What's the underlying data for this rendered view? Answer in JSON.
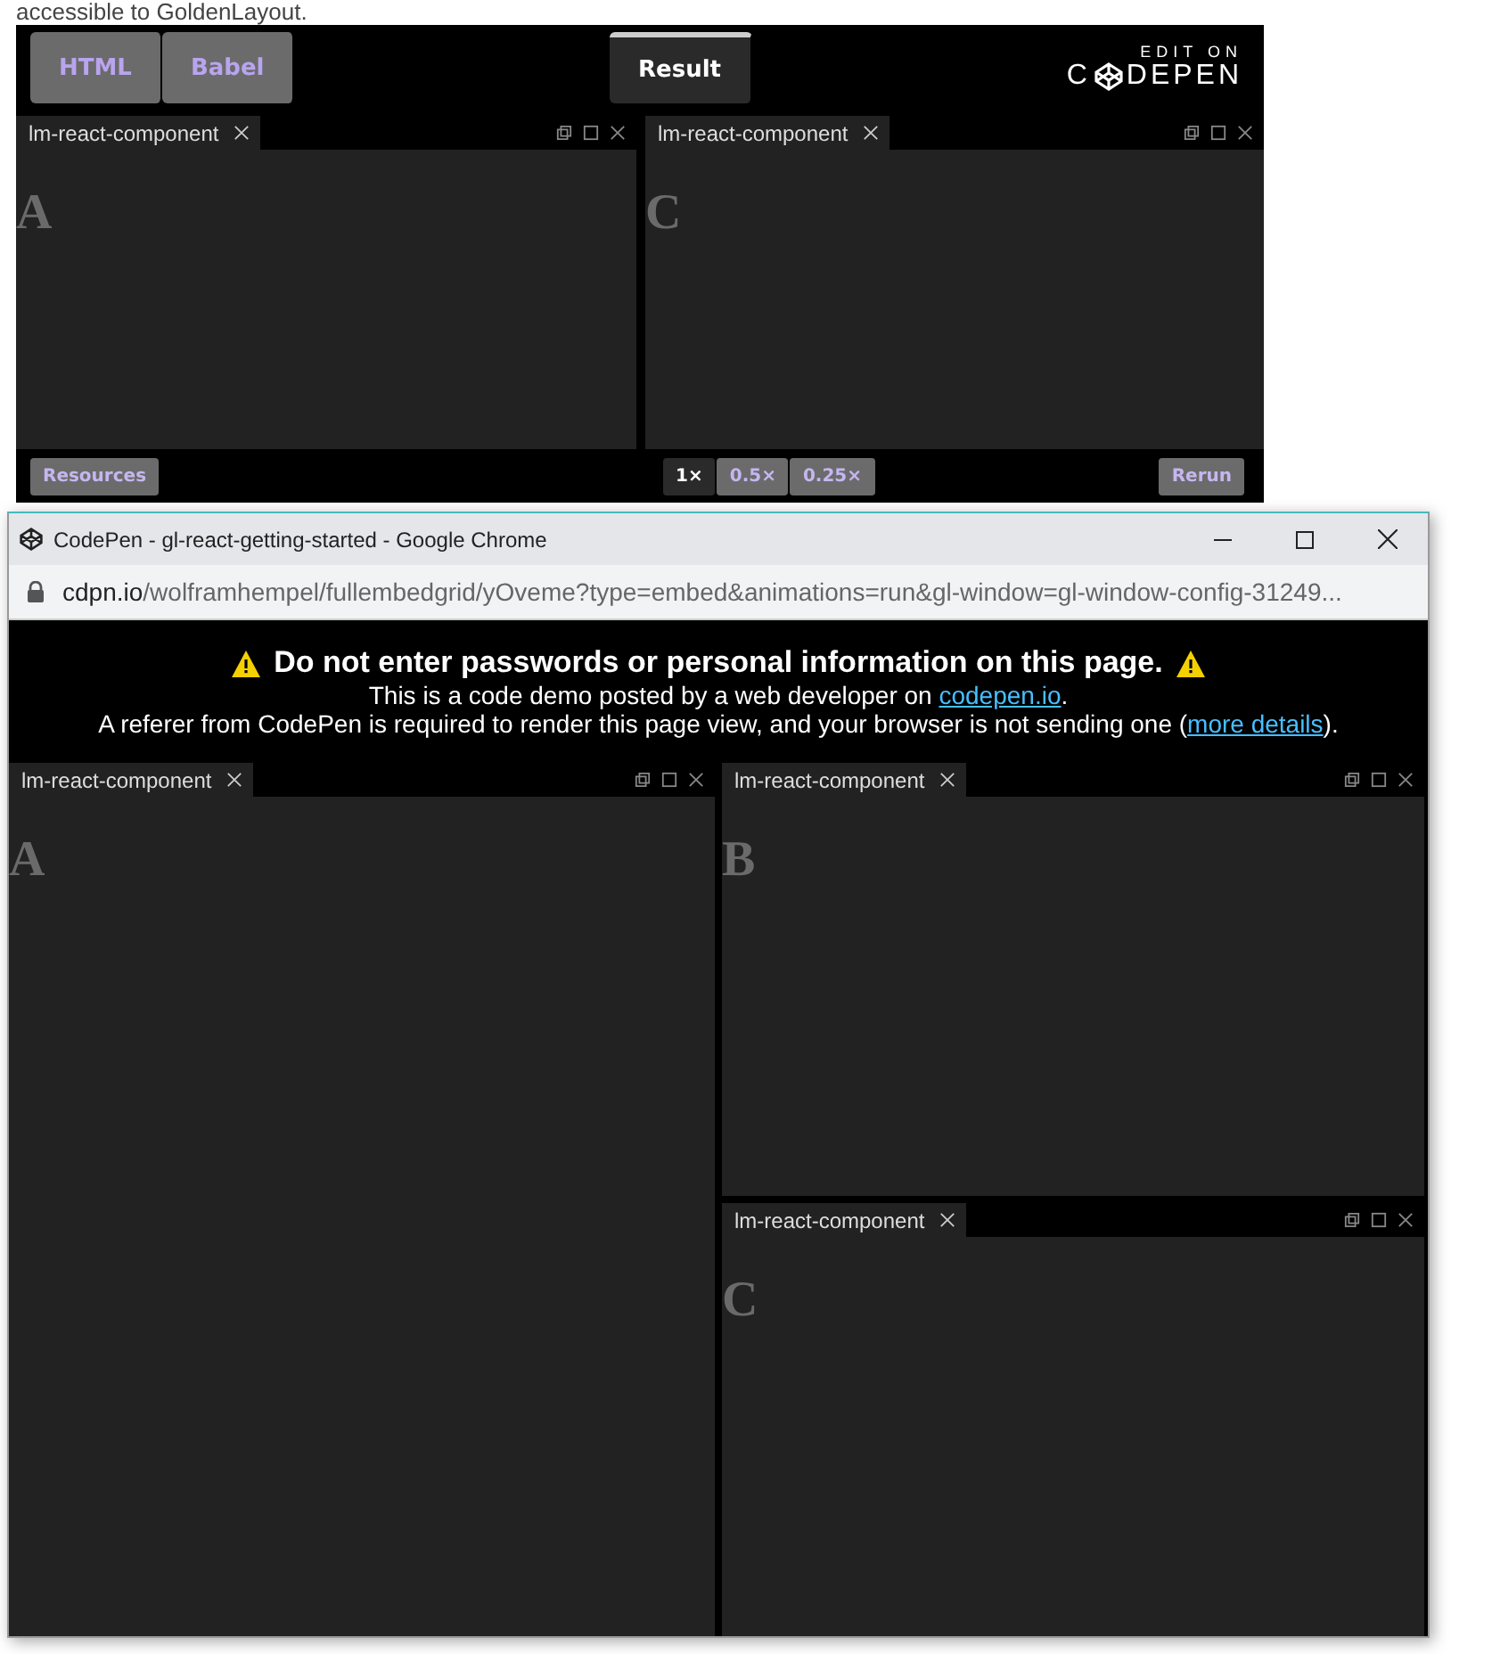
{
  "intro_text": "accessible to GoldenLayout.",
  "embed": {
    "tabs": [
      {
        "label": "HTML",
        "selected": false
      },
      {
        "label": "Babel",
        "selected": false
      },
      {
        "label": "Result",
        "selected": true
      }
    ],
    "brand": {
      "caption": "EDIT ON",
      "left": "C",
      "right": "DEPEN"
    },
    "panels": [
      {
        "title": "lm-react-component",
        "letter": "A"
      },
      {
        "title": "lm-react-component",
        "letter": "C"
      }
    ],
    "resources_button": "Resources",
    "zoom": [
      {
        "label": "1×",
        "selected": true
      },
      {
        "label": "0.5×",
        "selected": false
      },
      {
        "label": "0.25×",
        "selected": false
      }
    ],
    "rerun_button": "Rerun"
  },
  "browser": {
    "title": "CodePen - gl-react-getting-started - Google Chrome",
    "url_host": "cdpn.io",
    "url_path": "/wolframhempel/fullembedgrid/yOveme?type=embed&animations=run&gl-window=gl-window-config-31249...",
    "warning": {
      "heading": "Do not enter passwords or personal information on this page.",
      "line1": {
        "before": "This is a code demo posted by a web developer on ",
        "link": "codepen.io",
        "after": "."
      },
      "line2": {
        "before": "A referer from CodePen is required to render this page view, and your browser is not sending one (",
        "link": "more details",
        "after": ")."
      }
    },
    "left_panel": {
      "title": "lm-react-component",
      "letter": "A"
    },
    "right_panels": [
      {
        "title": "lm-react-component",
        "letter": "B"
      },
      {
        "title": "lm-react-component",
        "letter": "C"
      }
    ]
  }
}
